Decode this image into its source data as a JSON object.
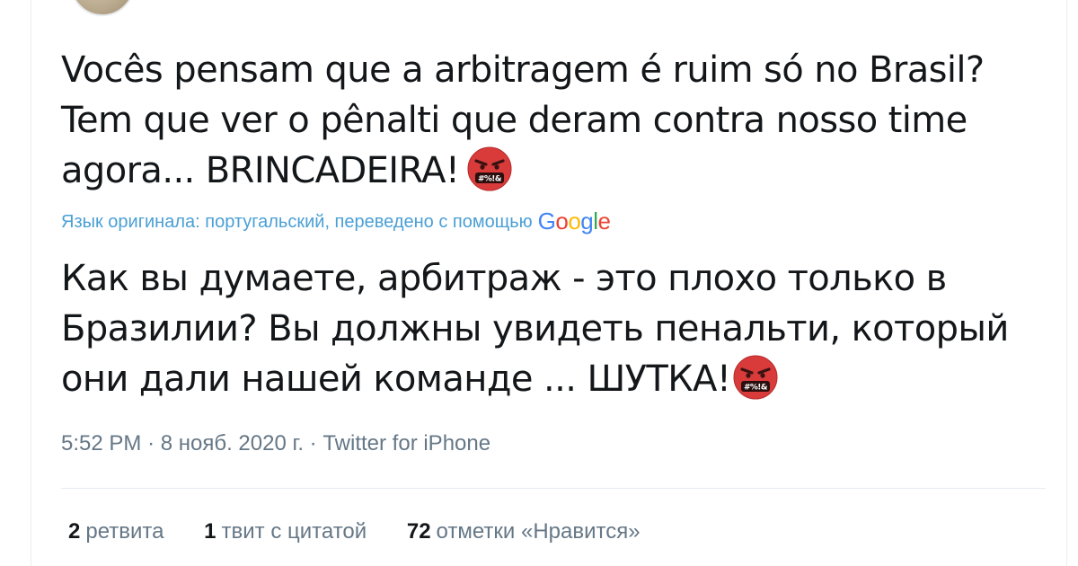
{
  "tweet": {
    "original_lines": [
      "Vocês pensam que a arbitragem é ruim só no Brasil?",
      "Tem que ver o pênalti que deram contra nosso time",
      "agora... BRINCADEIRA!"
    ],
    "translation_note": "Язык оригинала: португальский, переведено с помощью",
    "translation_provider": "Google",
    "translated_lines": [
      "Как вы думаете, арбитраж - это плохо только в",
      "Бразилии? Вы должны увидеть пенальти, который",
      "они дали нашей команде ... ШУТКА!"
    ],
    "emoji_text": "#%!&",
    "emoji_icon": "face-with-symbols-on-mouth-icon"
  },
  "meta": {
    "time": "5:52 PM",
    "separator": "·",
    "date": "8 нояб. 2020 г.",
    "source": "Twitter for iPhone"
  },
  "stats": {
    "retweets_count": "2",
    "retweets_label": "ретвита",
    "quotes_count": "1",
    "quotes_label": "твит с цитатой",
    "likes_count": "72",
    "likes_label": "отметки «Нравится»"
  },
  "colors": {
    "text": "#14171a",
    "secondary": "#657786",
    "link": "#4a9fd5",
    "emoji_red": "#d93b3b"
  }
}
